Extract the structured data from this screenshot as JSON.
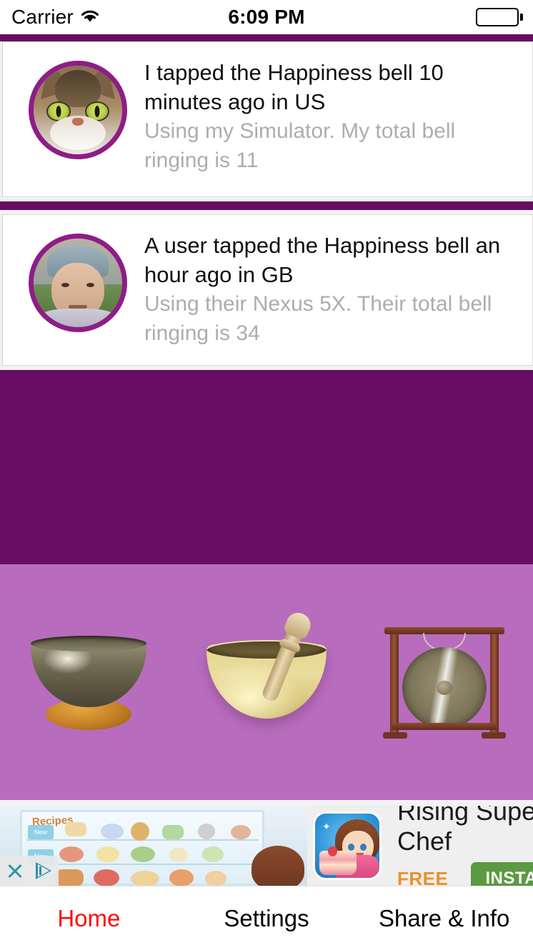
{
  "status_bar": {
    "carrier": "Carrier",
    "wifi_icon": "wifi-icon",
    "time": "6:09 PM",
    "battery_icon": "battery-full-icon"
  },
  "theme": {
    "band_purple": "#670d63",
    "bells_purple": "#b86cbd",
    "avatar_ring": "#8e1d86",
    "active_tab": "#ff0a0a",
    "subtitle_gray": "#adadad"
  },
  "feed": {
    "items": [
      {
        "avatar_name": "cat-avatar",
        "title": "I tapped the Happiness bell 10 minutes ago in US",
        "subtitle": "Using my Simulator. My total bell ringing is 11"
      },
      {
        "avatar_name": "user-photo-avatar",
        "title": "A user tapped the Happiness bell an hour ago in GB",
        "subtitle": "Using their Nexus 5X. Their total bell ringing is 34"
      }
    ]
  },
  "bells": {
    "items": [
      {
        "name": "dark-singing-bowl-on-cushion"
      },
      {
        "name": "golden-singing-bowl-with-mallet"
      },
      {
        "name": "gong-on-wooden-stand"
      }
    ]
  },
  "ad": {
    "close_icon": "close-x-icon",
    "adchoices_icon": "adchoices-icon",
    "app_icon": "rising-super-chef-app-icon",
    "title": "Rising Super Chef",
    "price": "FREE",
    "install_label": "INSTALL"
  },
  "tabbar": {
    "tabs": [
      {
        "label": "Home",
        "active": true
      },
      {
        "label": "Settings",
        "active": false
      },
      {
        "label": "Share & Info",
        "active": false
      }
    ]
  }
}
